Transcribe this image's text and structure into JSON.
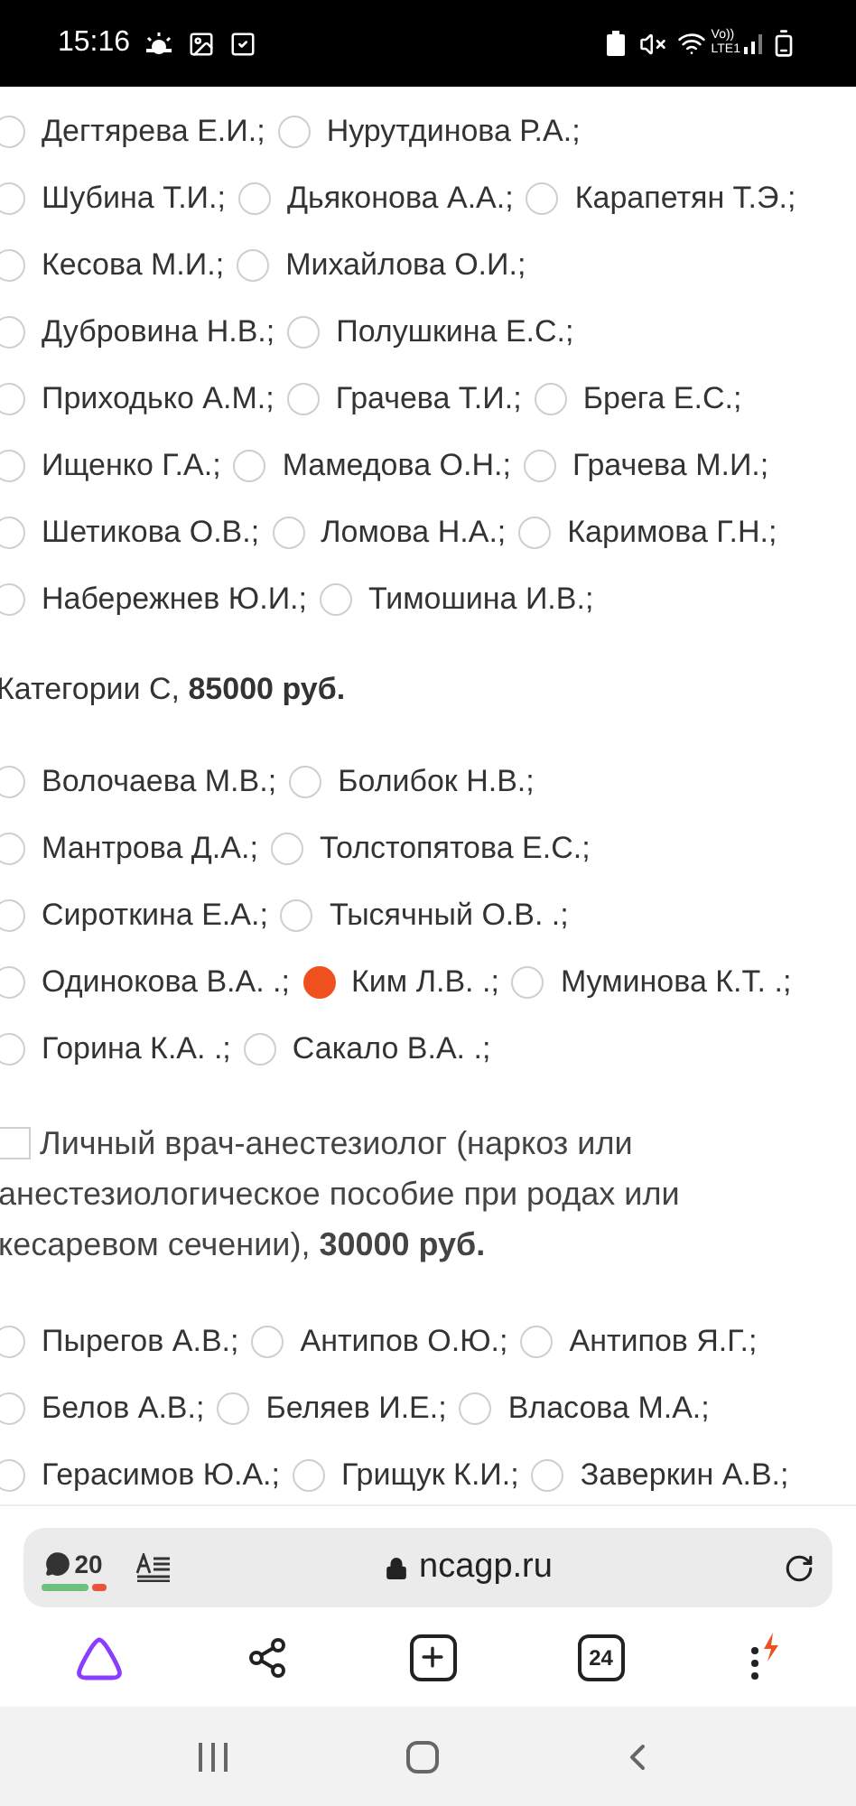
{
  "status_bar": {
    "time": "15:16",
    "volte": "Vo))",
    "network": "LTE1"
  },
  "sections": [
    {
      "kind": "options",
      "rows": [
        [
          {
            "label": "Дегтярева Е.И.;",
            "selected": false
          },
          {
            "label": "Нурутдинова Р.А.;",
            "selected": false
          }
        ],
        [
          {
            "label": "Шубина Т.И.;",
            "selected": false
          },
          {
            "label": "Дьяконова А.А.;",
            "selected": false
          },
          {
            "label": "Карапетян Т.Э.;",
            "selected": false
          }
        ],
        [
          {
            "label": "Кесова М.И.;",
            "selected": false
          },
          {
            "label": "Михайлова О.И.;",
            "selected": false
          }
        ],
        [
          {
            "label": "Дубровина Н.В.;",
            "selected": false
          },
          {
            "label": "Полушкина Е.С.;",
            "selected": false
          }
        ],
        [
          {
            "label": "Приходько А.М.;",
            "selected": false
          },
          {
            "label": "Грачева Т.И.;",
            "selected": false
          },
          {
            "label": "Брега Е.С.;",
            "selected": false
          }
        ],
        [
          {
            "label": "Ищенко Г.А.;",
            "selected": false
          },
          {
            "label": "Мамедова О.Н.;",
            "selected": false
          },
          {
            "label": "Грачева М.И.;",
            "selected": false
          }
        ],
        [
          {
            "label": "Шетикова О.В.;",
            "selected": false
          },
          {
            "label": "Ломова Н.А.;",
            "selected": false
          },
          {
            "label": "Каримова Г.Н.;",
            "selected": false
          }
        ],
        [
          {
            "label": "Набережнев Ю.И.;",
            "selected": false
          },
          {
            "label": "Тимошина И.В.;",
            "selected": false
          }
        ]
      ]
    },
    {
      "kind": "heading",
      "text": "Категории С, **85000 руб.**"
    },
    {
      "kind": "options",
      "rows": [
        [
          {
            "label": "Волочаева М.В.;",
            "selected": false
          },
          {
            "label": "Болибок Н.В.;",
            "selected": false
          }
        ],
        [
          {
            "label": "Мантрова Д.А.;",
            "selected": false
          },
          {
            "label": "Толстопятова Е.С.;",
            "selected": false
          }
        ],
        [
          {
            "label": "Сироткина Е.А.;",
            "selected": false
          },
          {
            "label": "Тысячный О.В. .;",
            "selected": false
          }
        ],
        [
          {
            "label": "Одинокова В.А. .;",
            "selected": false
          },
          {
            "label": "Ким Л.В. .;",
            "selected": true
          },
          {
            "label": "Муминова К.Т. .;",
            "selected": false
          }
        ],
        [
          {
            "label": "Горина К.А. .;",
            "selected": false
          },
          {
            "label": "Сакало В.А. .;",
            "selected": false
          }
        ]
      ]
    },
    {
      "kind": "checkbox",
      "checked": false,
      "text": "Личный врач-анестезиолог (наркоз или анестезиологическое пособие при родах или кесаревом сечении), **30000 руб.**"
    },
    {
      "kind": "options",
      "rows": [
        [
          {
            "label": "Пырегов А.В.;",
            "selected": false
          },
          {
            "label": "Антипов О.Ю.;",
            "selected": false
          },
          {
            "label": "Антипов Я.Г.;",
            "selected": false
          }
        ],
        [
          {
            "label": "Белов А.В.;",
            "selected": false
          },
          {
            "label": "Беляев И.Е.;",
            "selected": false
          },
          {
            "label": "Власова М.А.;",
            "selected": false
          }
        ],
        [
          {
            "label": "Герасимов Ю.А.;",
            "selected": false
          },
          {
            "label": "Грищук К.И.;",
            "selected": false
          },
          {
            "label": "Заверкин А.В.;",
            "selected": false
          }
        ]
      ]
    }
  ],
  "address_bar": {
    "comments": "20",
    "domain": "ncagp.ru"
  },
  "toolbar": {
    "tabs_count": "24"
  }
}
